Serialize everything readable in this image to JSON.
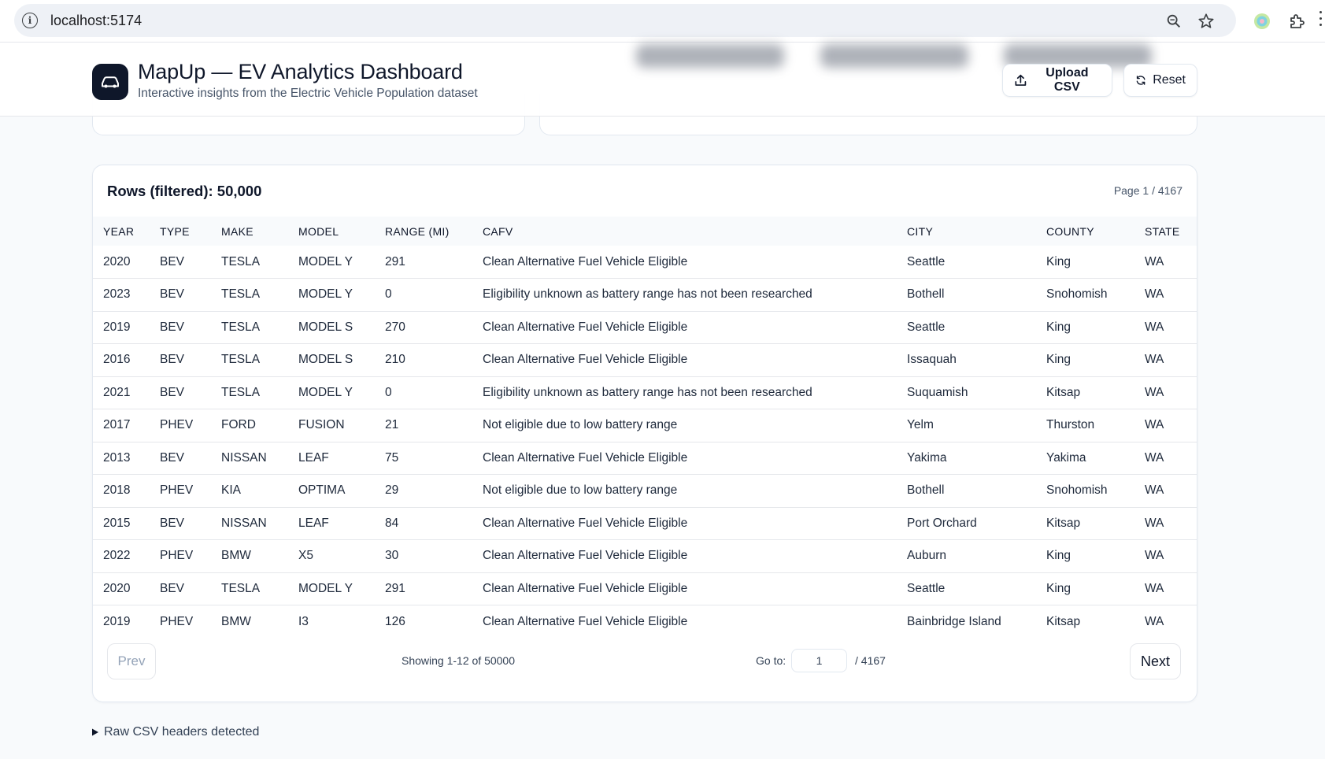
{
  "browser": {
    "url": "localhost:5174",
    "icons": [
      "info-icon",
      "zoom-icon",
      "bookmark-star-icon",
      "extension-color-icon",
      "extensions-puzzle-icon"
    ]
  },
  "header": {
    "title": "MapUp — EV Analytics Dashboard",
    "subtitle": "Interactive insights from the Electric Vehicle Population dataset",
    "upload_label": "Upload CSV",
    "reset_label": "Reset",
    "logo_icon": "car-icon"
  },
  "table_card": {
    "rows_label": "Rows (filtered): 50,000",
    "page_label": "Page 1 / 4167",
    "columns": [
      "YEAR",
      "TYPE",
      "MAKE",
      "MODEL",
      "RANGE (MI)",
      "CAFV",
      "CITY",
      "COUNTY",
      "STATE"
    ],
    "rows": [
      [
        "2020",
        "BEV",
        "TESLA",
        "MODEL Y",
        "291",
        "Clean Alternative Fuel Vehicle Eligible",
        "Seattle",
        "King",
        "WA"
      ],
      [
        "2023",
        "BEV",
        "TESLA",
        "MODEL Y",
        "0",
        "Eligibility unknown as battery range has not been researched",
        "Bothell",
        "Snohomish",
        "WA"
      ],
      [
        "2019",
        "BEV",
        "TESLA",
        "MODEL S",
        "270",
        "Clean Alternative Fuel Vehicle Eligible",
        "Seattle",
        "King",
        "WA"
      ],
      [
        "2016",
        "BEV",
        "TESLA",
        "MODEL S",
        "210",
        "Clean Alternative Fuel Vehicle Eligible",
        "Issaquah",
        "King",
        "WA"
      ],
      [
        "2021",
        "BEV",
        "TESLA",
        "MODEL Y",
        "0",
        "Eligibility unknown as battery range has not been researched",
        "Suquamish",
        "Kitsap",
        "WA"
      ],
      [
        "2017",
        "PHEV",
        "FORD",
        "FUSION",
        "21",
        "Not eligible due to low battery range",
        "Yelm",
        "Thurston",
        "WA"
      ],
      [
        "2013",
        "BEV",
        "NISSAN",
        "LEAF",
        "75",
        "Clean Alternative Fuel Vehicle Eligible",
        "Yakima",
        "Yakima",
        "WA"
      ],
      [
        "2018",
        "PHEV",
        "KIA",
        "OPTIMA",
        "29",
        "Not eligible due to low battery range",
        "Bothell",
        "Snohomish",
        "WA"
      ],
      [
        "2015",
        "BEV",
        "NISSAN",
        "LEAF",
        "84",
        "Clean Alternative Fuel Vehicle Eligible",
        "Port Orchard",
        "Kitsap",
        "WA"
      ],
      [
        "2022",
        "PHEV",
        "BMW",
        "X5",
        "30",
        "Clean Alternative Fuel Vehicle Eligible",
        "Auburn",
        "King",
        "WA"
      ],
      [
        "2020",
        "BEV",
        "TESLA",
        "MODEL Y",
        "291",
        "Clean Alternative Fuel Vehicle Eligible",
        "Seattle",
        "King",
        "WA"
      ],
      [
        "2019",
        "PHEV",
        "BMW",
        "I3",
        "126",
        "Clean Alternative Fuel Vehicle Eligible",
        "Bainbridge Island",
        "Kitsap",
        "WA"
      ]
    ]
  },
  "pager": {
    "prev_label": "Prev",
    "showing_text": "Showing 1-12 of 50000",
    "goto_label": "Go to:",
    "goto_value": "1",
    "goto_total": "/ 4167",
    "next_label": "Next"
  },
  "raw_headers": {
    "label": "Raw CSV headers detected"
  },
  "colors": {
    "accent_dark": "#0f172a",
    "muted_text": "#475569",
    "border": "#e2e8f0",
    "page_bg": "#f8fafc"
  }
}
